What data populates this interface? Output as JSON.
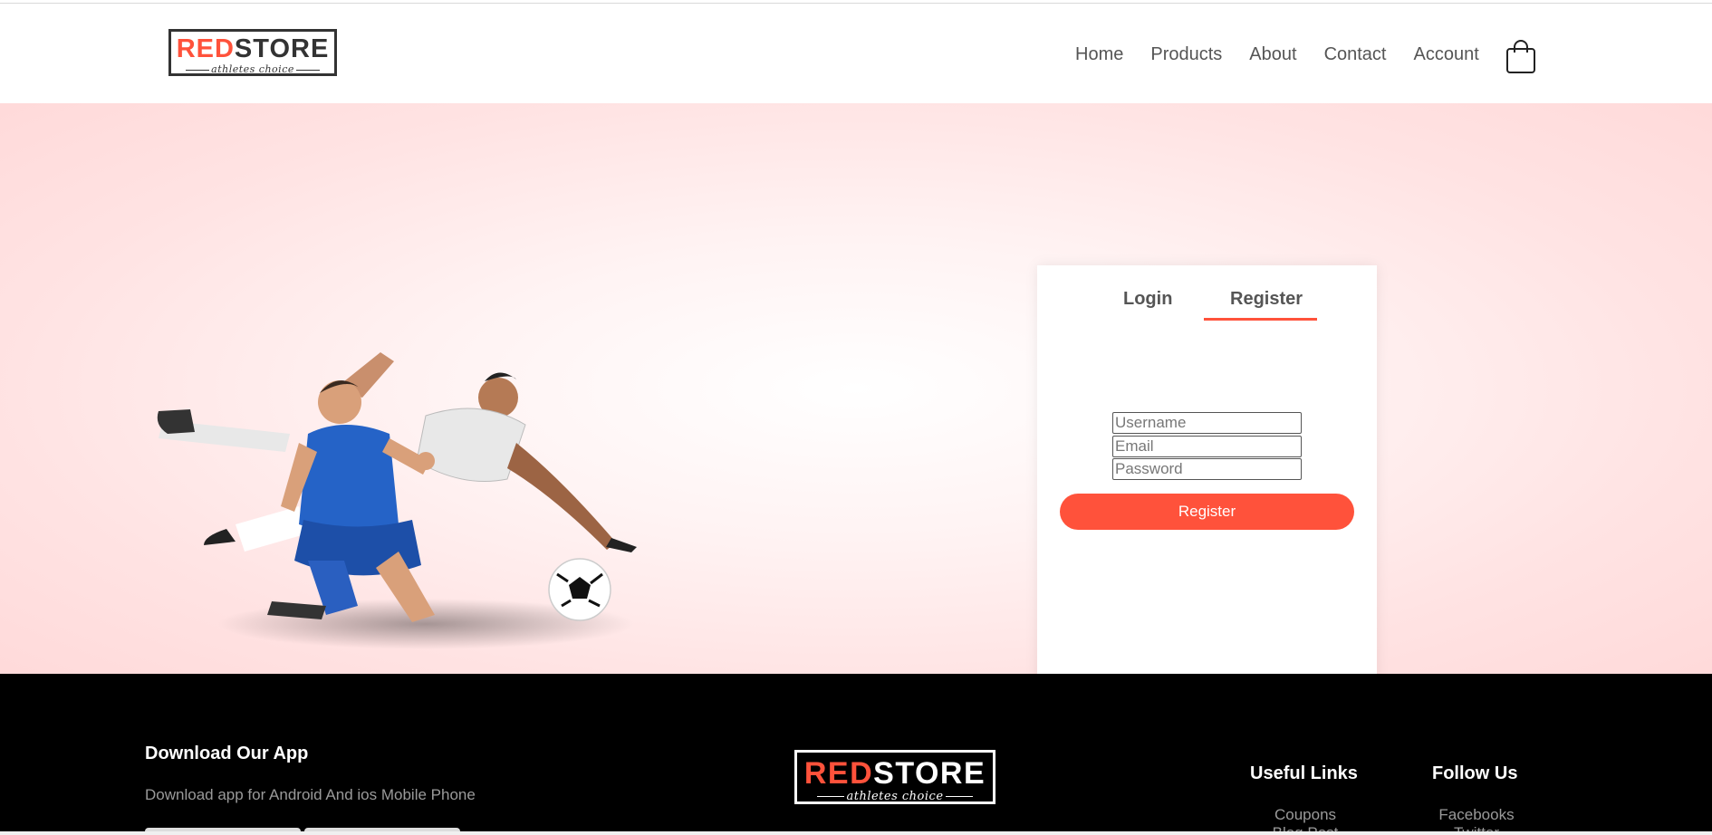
{
  "header": {
    "logo": {
      "brand_red": "RED",
      "brand_dark": "STORE",
      "tagline": "athletes choice"
    },
    "nav": [
      "Home",
      "Products",
      "About",
      "Contact",
      "Account"
    ],
    "cart_icon": "shopping-bag-icon"
  },
  "form": {
    "tabs": {
      "login": "Login",
      "register": "Register"
    },
    "active_tab": "Register",
    "fields": {
      "username_placeholder": "Username",
      "email_placeholder": "Email",
      "password_placeholder": "Password"
    },
    "submit_label": "Register"
  },
  "footer": {
    "download": {
      "title": "Download Our App",
      "text": "Download app for Android And ios Mobile Phone"
    },
    "logo": {
      "brand_red": "RED",
      "brand_white": "STORE",
      "tagline": "athletes choice"
    },
    "useful_links": {
      "title": "Useful Links",
      "items": [
        "Coupons",
        "Blog Post"
      ]
    },
    "follow_us": {
      "title": "Follow Us",
      "items": [
        "Facebooks",
        "Twitter"
      ]
    }
  },
  "colors": {
    "accent": "#ff523b",
    "hero_bg": "#ffe3e3",
    "footer_bg": "#000000"
  }
}
